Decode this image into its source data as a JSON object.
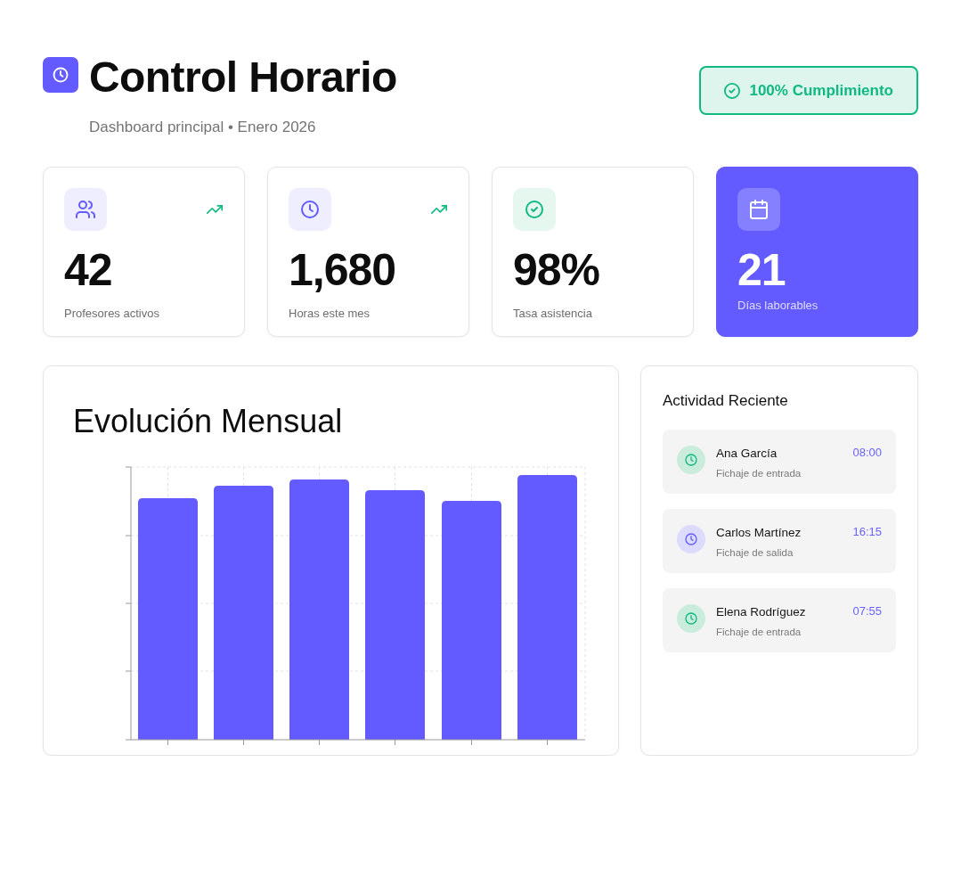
{
  "header": {
    "title": "Control Horario",
    "subtitle": "Dashboard principal • Enero 2026",
    "badge": "100% Cumplimiento"
  },
  "stats": [
    {
      "kind": "plain",
      "value": "42",
      "label": "Profesores activos",
      "trend_up": true
    },
    {
      "kind": "plain",
      "value": "1,680",
      "label": "Horas este mes",
      "trend_up": true
    },
    {
      "kind": "plain",
      "value": "98%",
      "label": "Tasa asistencia",
      "trend_up": false
    },
    {
      "kind": "accent",
      "value": "21",
      "label": "Días laborables",
      "trend_up": false
    }
  ],
  "chart_panel": {
    "title": "Evolución Mensual"
  },
  "activity": {
    "title": "Actividad Reciente",
    "items": [
      {
        "kind": "entry",
        "name": "Ana García",
        "action": "Fichaje de entrada",
        "time": "08:00"
      },
      {
        "kind": "exit",
        "name": "Carlos Martínez",
        "action": "Fichaje de salida",
        "time": "16:15"
      },
      {
        "kind": "entry",
        "name": "Elena Rodríguez",
        "action": "Fichaje de entrada",
        "time": "07:55"
      }
    ]
  }
}
